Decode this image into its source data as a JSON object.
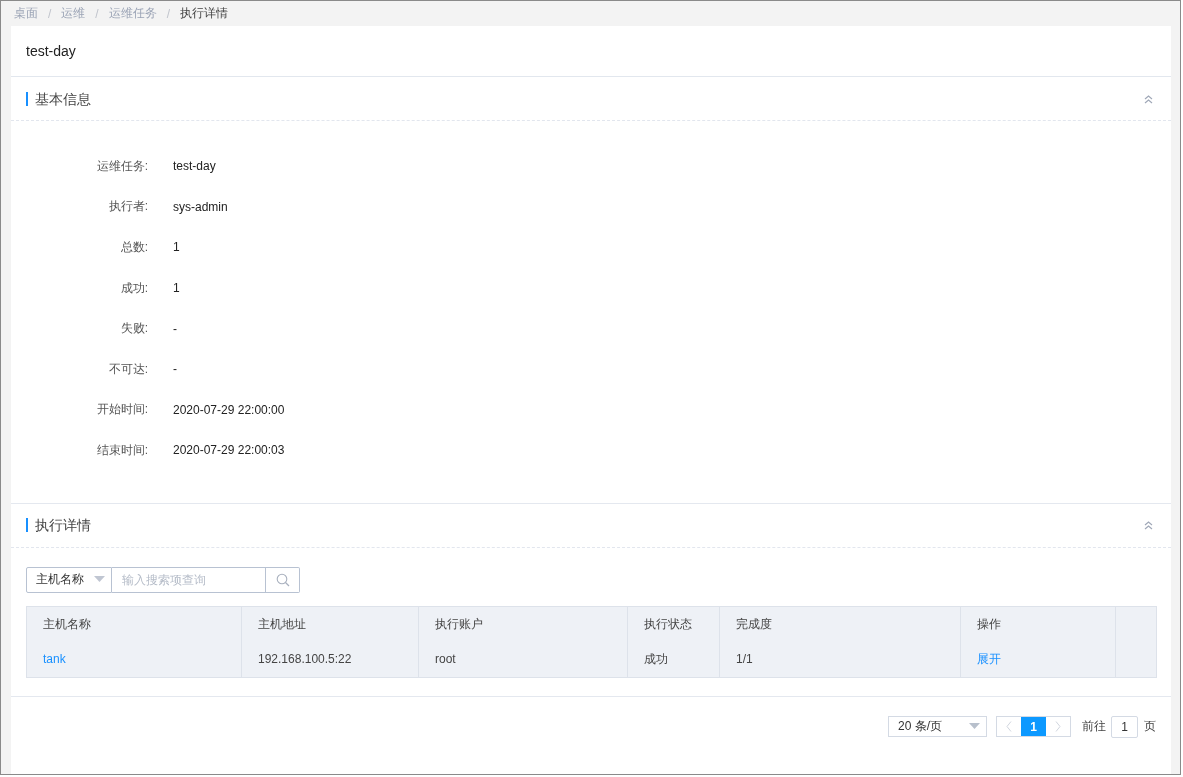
{
  "breadcrumb": [
    {
      "label": "桌面",
      "current": false
    },
    {
      "separator": "/",
      "label": "运维",
      "current": false
    },
    {
      "separator": "/",
      "label": "运维任务",
      "current": false
    },
    {
      "separator": "/",
      "label": "执行详情",
      "current": true
    }
  ],
  "page_title": "test-day",
  "basic_info": {
    "title": "基本信息",
    "expanded": true,
    "fields": [
      {
        "label": "运维任务:",
        "value": "test-day"
      },
      {
        "label": "执行者:",
        "value": "sys-admin"
      },
      {
        "label": "总数:",
        "value": "1"
      },
      {
        "label": "成功:",
        "value": "1"
      },
      {
        "label": "失败:",
        "value": "-"
      },
      {
        "label": "不可达:",
        "value": "-"
      },
      {
        "label": "开始时间:",
        "value": "2020-07-29 22:00:00"
      },
      {
        "label": "结束时间:",
        "value": "2020-07-29 22:00:03"
      }
    ]
  },
  "exec_details": {
    "title": "执行详情",
    "expanded": true,
    "search": {
      "field": "主机名称",
      "placeholder": "输入搜索项查询"
    },
    "table": {
      "columns": [
        "主机名称",
        "主机地址",
        "执行账户",
        "执行状态",
        "完成度",
        "操作"
      ],
      "rows": [
        [
          {
            "text": "tank",
            "kind": "link"
          },
          {
            "text": "192.168.100.5:22",
            "kind": "text"
          },
          {
            "text": "root",
            "kind": "text"
          },
          {
            "text": "成功",
            "kind": "text"
          },
          {
            "text": "1/1",
            "kind": "text"
          },
          {
            "text": "展开",
            "kind": "link"
          }
        ]
      ]
    }
  },
  "pagination": {
    "page_size": "20 条/页",
    "pages": [
      {
        "label": "1",
        "selected": true
      }
    ],
    "goto_label": "前往",
    "goto_value": "1",
    "page_suffix": "页"
  }
}
